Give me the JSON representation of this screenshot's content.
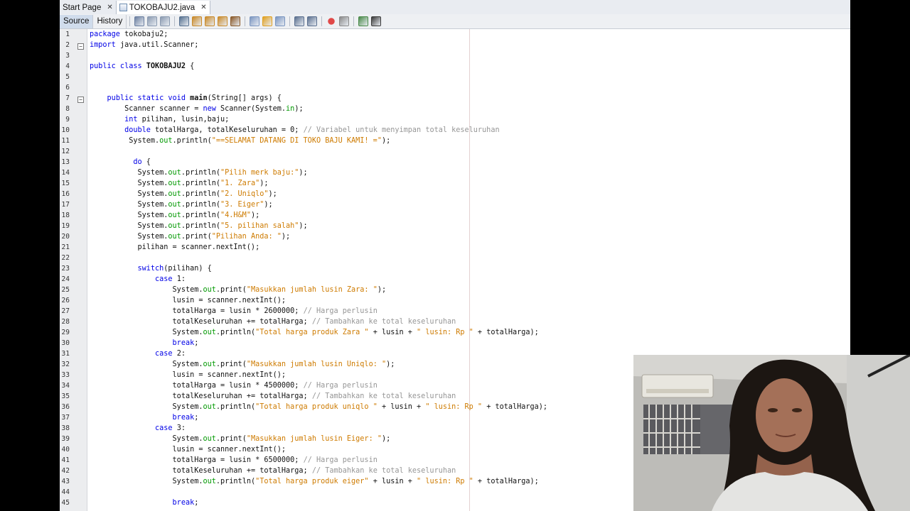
{
  "tabs": [
    {
      "label": "Start Page",
      "active": false
    },
    {
      "label": "TOKOBAJU2.java",
      "active": true
    }
  ],
  "toolbar": {
    "source_label": "Source",
    "history_label": "History",
    "icons": [
      "last-edit-icon",
      "back-icon",
      "forward-icon",
      "find-icon",
      "find-prev-icon",
      "find-next-icon",
      "toggle-highlight-icon",
      "toggle-rect-icon",
      "prev-bookmark-icon",
      "next-bookmark-icon",
      "toggle-bookmark-icon",
      "shift-left-icon",
      "shift-right-icon",
      "record-macro-icon",
      "stop-macro-icon",
      "comment-icon",
      "uncomment-icon"
    ]
  },
  "colors": {
    "keyword": "#0000e6",
    "string": "#ce7b00",
    "comment": "#969696",
    "field": "#009900"
  },
  "code_lines": [
    {
      "n": "1",
      "fold": "",
      "indent": "",
      "segs": [
        [
          "kw",
          "package"
        ],
        [
          "",
          "tokobaju2;"
        ]
      ]
    },
    {
      "n": "2",
      "fold": "-",
      "indent": "",
      "segs": [
        [
          "kw",
          "import"
        ],
        [
          "",
          "java.util.Scanner;"
        ]
      ]
    },
    {
      "n": "3",
      "fold": "",
      "indent": "",
      "segs": []
    },
    {
      "n": "4",
      "fold": "",
      "indent": "",
      "segs": [
        [
          "kw",
          "public class"
        ],
        [
          "bold",
          "TOKOBAJU2"
        ],
        [
          "",
          "{"
        ]
      ]
    },
    {
      "n": "5",
      "fold": "",
      "indent": "",
      "segs": []
    },
    {
      "n": "6",
      "fold": "",
      "indent": "",
      "segs": []
    },
    {
      "n": "7",
      "fold": "-",
      "indent": "    ",
      "segs": [
        [
          "kw",
          "public static void"
        ],
        [
          "bold",
          "main"
        ],
        [
          "",
          "(String[] args) {"
        ]
      ]
    },
    {
      "n": "8",
      "fold": "",
      "indent": "        ",
      "segs": [
        [
          "",
          "Scanner scanner = "
        ],
        [
          "kw",
          "new"
        ],
        [
          "",
          "Scanner(System."
        ],
        [
          "fld",
          "in"
        ],
        [
          "",
          ");"
        ]
      ]
    },
    {
      "n": "9",
      "fold": "",
      "indent": "        ",
      "segs": [
        [
          "kw",
          "int"
        ],
        [
          "",
          "pilihan, lusin,baju;"
        ]
      ]
    },
    {
      "n": "10",
      "fold": "",
      "indent": "        ",
      "segs": [
        [
          "kw",
          "double"
        ],
        [
          "",
          "totalHarga, totalKeseluruhan = 0; "
        ],
        [
          "cmt",
          "// Variabel untuk menyimpan total keseluruhan"
        ]
      ]
    },
    {
      "n": "11",
      "fold": "",
      "indent": "         ",
      "segs": [
        [
          "",
          "System."
        ],
        [
          "fld",
          "out"
        ],
        [
          "",
          ".println("
        ],
        [
          "str",
          "\"==SELAMAT DATANG DI TOKO BAJU KAMI! =\""
        ],
        [
          "",
          ");"
        ]
      ]
    },
    {
      "n": "12",
      "fold": "",
      "indent": "",
      "segs": []
    },
    {
      "n": "13",
      "fold": "",
      "indent": "          ",
      "segs": [
        [
          "kw",
          "do"
        ],
        [
          "",
          "{"
        ]
      ]
    },
    {
      "n": "14",
      "fold": "",
      "indent": "           ",
      "segs": [
        [
          "",
          "System."
        ],
        [
          "fld",
          "out"
        ],
        [
          "",
          ".println("
        ],
        [
          "str",
          "\"Pilih merk baju:\""
        ],
        [
          "",
          ");"
        ]
      ]
    },
    {
      "n": "15",
      "fold": "",
      "indent": "           ",
      "segs": [
        [
          "",
          "System."
        ],
        [
          "fld",
          "out"
        ],
        [
          "",
          ".println("
        ],
        [
          "str",
          "\"1. Zara\""
        ],
        [
          "",
          ");"
        ]
      ]
    },
    {
      "n": "16",
      "fold": "",
      "indent": "           ",
      "segs": [
        [
          "",
          "System."
        ],
        [
          "fld",
          "out"
        ],
        [
          "",
          ".println("
        ],
        [
          "str",
          "\"2. Uniqlo\""
        ],
        [
          "",
          ");"
        ]
      ]
    },
    {
      "n": "17",
      "fold": "",
      "indent": "           ",
      "segs": [
        [
          "",
          "System."
        ],
        [
          "fld",
          "out"
        ],
        [
          "",
          ".println("
        ],
        [
          "str",
          "\"3. Eiger\""
        ],
        [
          "",
          ");"
        ]
      ]
    },
    {
      "n": "18",
      "fold": "",
      "indent": "           ",
      "segs": [
        [
          "",
          "System."
        ],
        [
          "fld",
          "out"
        ],
        [
          "",
          ".println("
        ],
        [
          "str",
          "\"4.H&M\""
        ],
        [
          "",
          ");"
        ]
      ]
    },
    {
      "n": "19",
      "fold": "",
      "indent": "           ",
      "segs": [
        [
          "",
          "System."
        ],
        [
          "fld",
          "out"
        ],
        [
          "",
          ".println("
        ],
        [
          "str",
          "\"5. pilihan salah\""
        ],
        [
          "",
          ");"
        ]
      ]
    },
    {
      "n": "20",
      "fold": "",
      "indent": "           ",
      "segs": [
        [
          "",
          "System."
        ],
        [
          "fld",
          "out"
        ],
        [
          "",
          ".print("
        ],
        [
          "str",
          "\"Pilihan Anda: \""
        ],
        [
          "",
          ");"
        ]
      ]
    },
    {
      "n": "21",
      "fold": "",
      "indent": "           ",
      "segs": [
        [
          "",
          "pilihan = scanner.nextInt();"
        ]
      ]
    },
    {
      "n": "22",
      "fold": "",
      "indent": "",
      "segs": []
    },
    {
      "n": "23",
      "fold": "",
      "indent": "           ",
      "segs": [
        [
          "kw",
          "switch"
        ],
        [
          "",
          "(pilihan) {"
        ]
      ]
    },
    {
      "n": "24",
      "fold": "",
      "indent": "               ",
      "segs": [
        [
          "kw",
          "case"
        ],
        [
          "",
          "1:"
        ]
      ]
    },
    {
      "n": "25",
      "fold": "",
      "indent": "                   ",
      "segs": [
        [
          "",
          "System."
        ],
        [
          "fld",
          "out"
        ],
        [
          "",
          ".print("
        ],
        [
          "str",
          "\"Masukkan jumlah lusin Zara: \""
        ],
        [
          "",
          ");"
        ]
      ]
    },
    {
      "n": "26",
      "fold": "",
      "indent": "                   ",
      "segs": [
        [
          "",
          "lusin = scanner.nextInt();"
        ]
      ]
    },
    {
      "n": "27",
      "fold": "",
      "indent": "                   ",
      "segs": [
        [
          "",
          "totalHarga = lusin * 2600000; "
        ],
        [
          "cmt",
          "// Harga perlusin"
        ]
      ]
    },
    {
      "n": "28",
      "fold": "",
      "indent": "                   ",
      "segs": [
        [
          "",
          "totalKeseluruhan += totalHarga; "
        ],
        [
          "cmt",
          "// Tambahkan ke total keseluruhan"
        ]
      ]
    },
    {
      "n": "29",
      "fold": "",
      "indent": "                   ",
      "segs": [
        [
          "",
          "System."
        ],
        [
          "fld",
          "out"
        ],
        [
          "",
          ".println("
        ],
        [
          "str",
          "\"Total harga produk Zara \""
        ],
        [
          "",
          "+ lusin + "
        ],
        [
          "str",
          "\" lusin: Rp \""
        ],
        [
          "",
          "+ totalHarga);"
        ]
      ]
    },
    {
      "n": "30",
      "fold": "",
      "indent": "                   ",
      "segs": [
        [
          "kw",
          "break"
        ],
        [
          "",
          ";"
        ]
      ]
    },
    {
      "n": "31",
      "fold": "",
      "indent": "               ",
      "segs": [
        [
          "kw",
          "case"
        ],
        [
          "",
          "2:"
        ]
      ]
    },
    {
      "n": "32",
      "fold": "",
      "indent": "                   ",
      "segs": [
        [
          "",
          "System."
        ],
        [
          "fld",
          "out"
        ],
        [
          "",
          ".print("
        ],
        [
          "str",
          "\"Masukkan jumlah lusin Uniqlo: \""
        ],
        [
          "",
          ");"
        ]
      ]
    },
    {
      "n": "33",
      "fold": "",
      "indent": "                   ",
      "segs": [
        [
          "",
          "lusin = scanner.nextInt();"
        ]
      ]
    },
    {
      "n": "34",
      "fold": "",
      "indent": "                   ",
      "segs": [
        [
          "",
          "totalHarga = lusin * 4500000; "
        ],
        [
          "cmt",
          "// Harga perlusin"
        ]
      ]
    },
    {
      "n": "35",
      "fold": "",
      "indent": "                   ",
      "segs": [
        [
          "",
          "totalKeseluruhan += totalHarga; "
        ],
        [
          "cmt",
          "// Tambahkan ke total keseluruhan"
        ]
      ]
    },
    {
      "n": "36",
      "fold": "",
      "indent": "                   ",
      "segs": [
        [
          "",
          "System."
        ],
        [
          "fld",
          "out"
        ],
        [
          "",
          ".println("
        ],
        [
          "str",
          "\"Total harga produk uniqlo \""
        ],
        [
          "",
          "+ lusin + "
        ],
        [
          "str",
          "\" lusin: Rp \""
        ],
        [
          "",
          "+ totalHarga);"
        ]
      ]
    },
    {
      "n": "37",
      "fold": "",
      "indent": "                   ",
      "segs": [
        [
          "kw",
          "break"
        ],
        [
          "",
          ";"
        ]
      ]
    },
    {
      "n": "38",
      "fold": "",
      "indent": "               ",
      "segs": [
        [
          "kw",
          "case"
        ],
        [
          "",
          "3:"
        ]
      ]
    },
    {
      "n": "39",
      "fold": "",
      "indent": "                   ",
      "segs": [
        [
          "",
          "System."
        ],
        [
          "fld",
          "out"
        ],
        [
          "",
          ".print("
        ],
        [
          "str",
          "\"Masukkan jumlah lusin Eiger: \""
        ],
        [
          "",
          ");"
        ]
      ]
    },
    {
      "n": "40",
      "fold": "",
      "indent": "                   ",
      "segs": [
        [
          "",
          "lusin = scanner.nextInt();"
        ]
      ]
    },
    {
      "n": "41",
      "fold": "",
      "indent": "                   ",
      "segs": [
        [
          "",
          "totalHarga = lusin * 6500000; "
        ],
        [
          "cmt",
          "// Harga perlusin"
        ]
      ]
    },
    {
      "n": "42",
      "fold": "",
      "indent": "                   ",
      "segs": [
        [
          "",
          "totalKeseluruhan += totalHarga; "
        ],
        [
          "cmt",
          "// Tambahkan ke total keseluruhan"
        ]
      ]
    },
    {
      "n": "43",
      "fold": "",
      "indent": "                   ",
      "segs": [
        [
          "",
          "System."
        ],
        [
          "fld",
          "out"
        ],
        [
          "",
          ".println("
        ],
        [
          "str",
          "\"Total harga produk eiger\""
        ],
        [
          "",
          "+ lusin + "
        ],
        [
          "str",
          "\" lusin: Rp \""
        ],
        [
          "",
          "+ totalHarga);"
        ]
      ]
    },
    {
      "n": "44",
      "fold": "",
      "indent": "",
      "segs": []
    },
    {
      "n": "45",
      "fold": "",
      "indent": "                   ",
      "segs": [
        [
          "kw",
          "break"
        ],
        [
          "",
          ";"
        ]
      ]
    }
  ]
}
